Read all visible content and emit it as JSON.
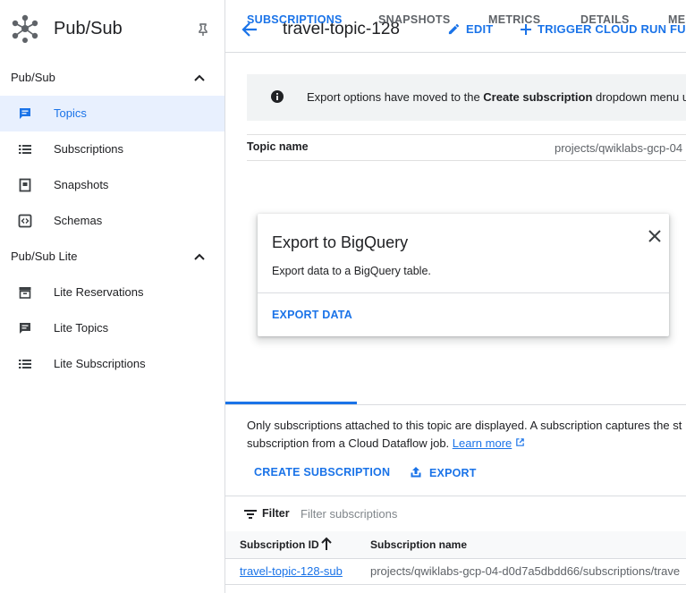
{
  "app": {
    "title": "Pub/Sub",
    "logo_icon": "pubsub-hub-icon",
    "pin_icon": "pin-icon"
  },
  "sidebar": {
    "sections": [
      {
        "label": "Pub/Sub",
        "items": [
          {
            "label": "Topics",
            "icon": "topics-icon",
            "active": true
          },
          {
            "label": "Subscriptions",
            "icon": "list-icon"
          },
          {
            "label": "Snapshots",
            "icon": "snapshot-icon"
          },
          {
            "label": "Schemas",
            "icon": "code-icon"
          }
        ]
      },
      {
        "label": "Pub/Sub Lite",
        "items": [
          {
            "label": "Lite Reservations",
            "icon": "reservations-icon"
          },
          {
            "label": "Lite Topics",
            "icon": "topics-icon"
          },
          {
            "label": "Lite Subscriptions",
            "icon": "list-icon"
          }
        ]
      }
    ]
  },
  "header": {
    "title": "travel-topic-128",
    "edit_label": "EDIT",
    "trigger_label": "TRIGGER CLOUD RUN FUNCT"
  },
  "banner": {
    "text_before": "Export options have moved to the ",
    "text_bold": "Create subscription",
    "text_after": " dropdown menu un"
  },
  "topic": {
    "name_label": "Topic name",
    "name_value": "projects/qwiklabs-gcp-04"
  },
  "popup": {
    "title": "Export to BigQuery",
    "description": "Export data to a BigQuery table.",
    "action": "EXPORT DATA"
  },
  "tabs": [
    {
      "label": "SUBSCRIPTIONS",
      "active": true
    },
    {
      "label": "SNAPSHOTS"
    },
    {
      "label": "METRICS"
    },
    {
      "label": "DETAILS"
    },
    {
      "label": "ME"
    }
  ],
  "subscriptions_panel": {
    "desc_line1": "Only subscriptions attached to this topic are displayed. A subscription captures the st",
    "desc_line2": "subscription from a Cloud Dataflow job. ",
    "learn_more": "Learn more",
    "create_label": "CREATE SUBSCRIPTION",
    "export_label": "EXPORT",
    "filter_label": "Filter",
    "filter_placeholder": "Filter subscriptions",
    "columns": [
      "Subscription ID",
      "Subscription name"
    ],
    "rows": [
      {
        "id": "travel-topic-128-sub",
        "name": "projects/qwiklabs-gcp-04-d0d7a5dbdd66/subscriptions/trave"
      }
    ]
  },
  "colors": {
    "accent": "#1a73e8",
    "active_bg": "#e8f0fe",
    "banner_bg": "#f1f3f4"
  }
}
